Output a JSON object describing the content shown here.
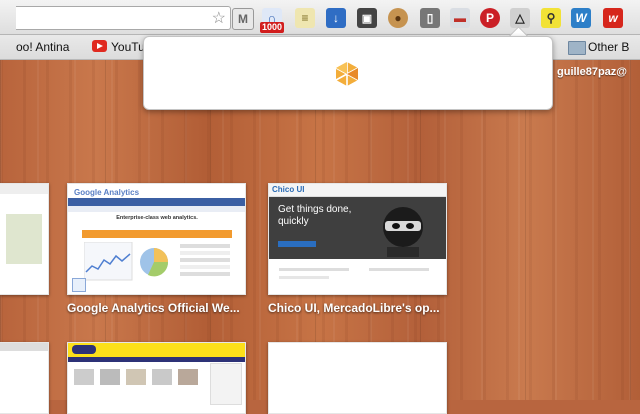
{
  "bookmarks": {
    "item1": "oo! Antina",
    "item2": "YouTu",
    "item3": "Other B"
  },
  "extensions": {
    "badge_count": "1000",
    "monitor_label": "W"
  },
  "user": {
    "name": "guille87paz@"
  },
  "thumbnails": [
    {
      "caption": "Google Analytics Official We...",
      "logo": "Google Analytics",
      "headline": "Enterprise-class web analytics."
    },
    {
      "caption": "Chico UI, MercadoLibre's op...",
      "logo": "Chico UI",
      "headline_line1": "Get things done,",
      "headline_line2": "quickly"
    }
  ],
  "colors": {
    "wood_base": "#b8653f",
    "popup_icon": "#f0a030",
    "youtube_red": "#e02a20",
    "pinterest_red": "#cb2027"
  }
}
